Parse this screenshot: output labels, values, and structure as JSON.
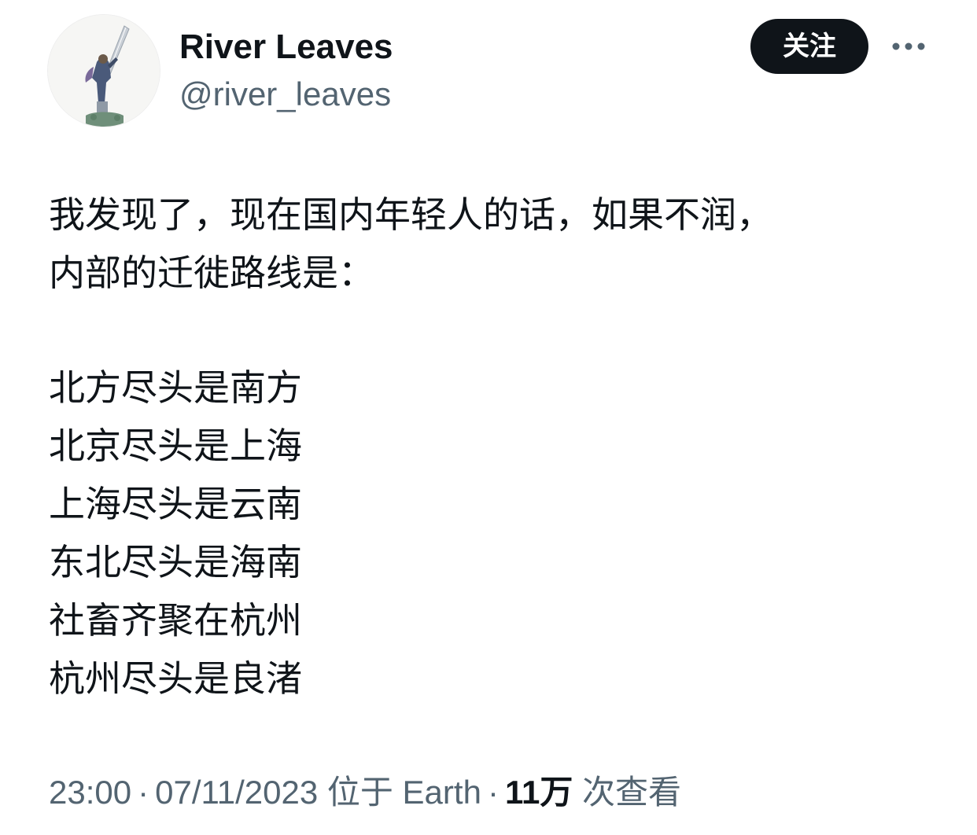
{
  "author": {
    "display_name": "River Leaves",
    "handle": "@river_leaves",
    "avatar_icon": "statue-avatar-icon"
  },
  "actions": {
    "follow_label": "关注",
    "more_icon": "more-horizontal-icon"
  },
  "tweet": {
    "intro_lines": [
      "我发现了，现在国内年轻人的话，如果不润，",
      "内部的迁徙路线是："
    ],
    "poem_lines": [
      "北方尽头是南方",
      "北京尽头是上海",
      "上海尽头是云南",
      "东北尽头是海南",
      "社畜齐聚在杭州",
      "杭州尽头是良渚"
    ]
  },
  "meta": {
    "time": "23:00",
    "separator": "·",
    "date": "07/11/2023",
    "location": "位于 Earth",
    "views_count": "11万",
    "views_label": "次查看"
  },
  "colors": {
    "text_primary": "#0f1419",
    "text_secondary": "#536471",
    "button_bg": "#0f1419",
    "button_text": "#ffffff"
  }
}
